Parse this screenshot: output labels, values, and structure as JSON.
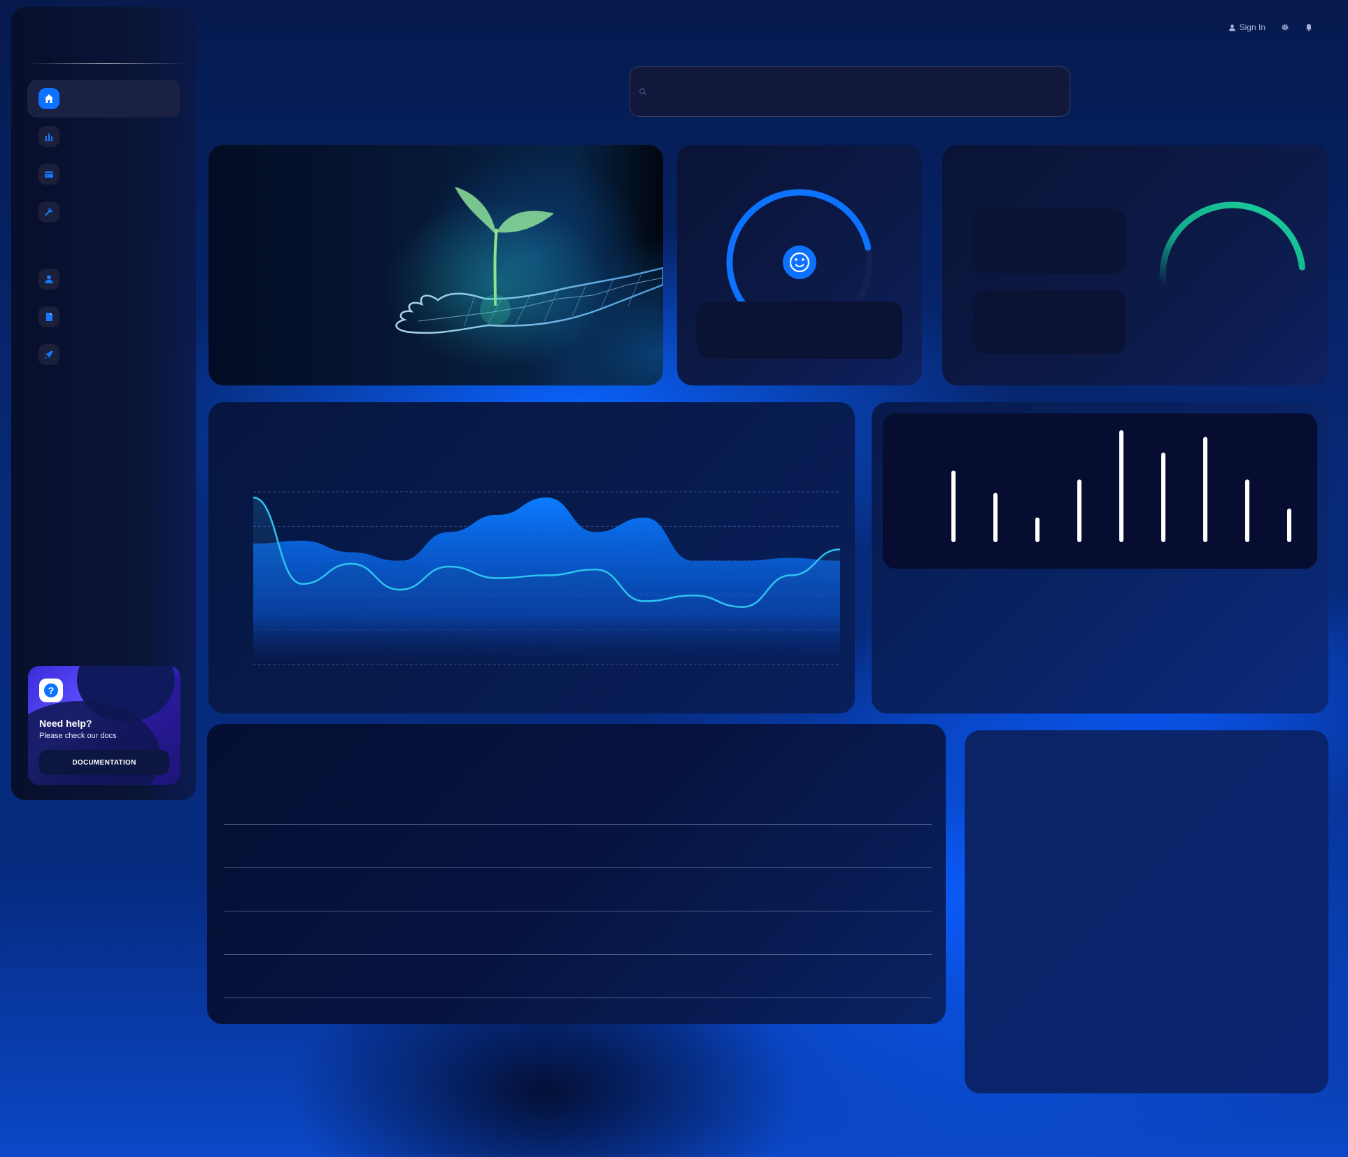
{
  "sidebar": {
    "nav": [
      {
        "icon": "home-icon",
        "active": true
      },
      {
        "icon": "bar-chart-icon",
        "active": false
      },
      {
        "icon": "credit-card-icon",
        "active": false
      },
      {
        "icon": "wrench-icon",
        "active": false
      },
      {
        "icon": "person-icon",
        "active": false
      },
      {
        "icon": "document-icon",
        "active": false
      },
      {
        "icon": "rocket-icon",
        "active": false
      }
    ],
    "help": {
      "title": "Need help?",
      "subtitle": "Please check our docs",
      "button": "DOCUMENTATION",
      "icon": "question-icon"
    }
  },
  "topbar": {
    "signin": "Sign In",
    "icons": [
      "user-icon",
      "gear-icon",
      "bell-icon"
    ]
  },
  "search": {
    "icon": "search-icon",
    "placeholder": ""
  },
  "satisfaction": {
    "icon": "smiley-icon",
    "fraction": 0.8
  },
  "referral": {
    "fraction": 0.7
  },
  "colors": {
    "accent": "#0d72ff",
    "teal": "#14b88f",
    "cyan": "#2ec4f0"
  },
  "chart_data": [
    {
      "type": "area",
      "series": [
        {
          "values": [
            210,
            215,
            195,
            180,
            230,
            260,
            290,
            230,
            255,
            180,
            180,
            185,
            180
          ]
        },
        {
          "values": [
            290,
            140,
            175,
            130,
            170,
            150,
            155,
            165,
            110,
            120,
            100,
            155,
            200
          ]
        }
      ]
    },
    {
      "type": "bar",
      "values": [
        320,
        220,
        110,
        280,
        500,
        400,
        470,
        280,
        150
      ]
    }
  ]
}
